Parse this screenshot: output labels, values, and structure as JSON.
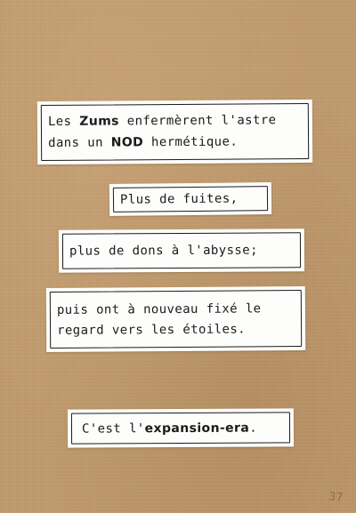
{
  "strips": [
    {
      "lines": [
        {
          "before": "Les ",
          "emph": "Zums",
          "after": " enfermèrent l'astre"
        },
        {
          "before": "dans un ",
          "emph": "NOD",
          "after": " hermétique."
        }
      ]
    },
    {
      "lines": [
        {
          "before": "Plus de fuites,",
          "emph": "",
          "after": ""
        }
      ]
    },
    {
      "lines": [
        {
          "before": "plus de dons à l'abysse;",
          "emph": "",
          "after": ""
        }
      ]
    },
    {
      "lines": [
        {
          "before": "puis ont à nouveau fixé le",
          "emph": "",
          "after": ""
        },
        {
          "before": "regard vers les étoiles.",
          "emph": "",
          "after": ""
        }
      ]
    },
    {
      "lines": [
        {
          "before": "C'est l'",
          "emph": "expansion-era",
          "after": "."
        }
      ]
    }
  ],
  "page_number": "37"
}
